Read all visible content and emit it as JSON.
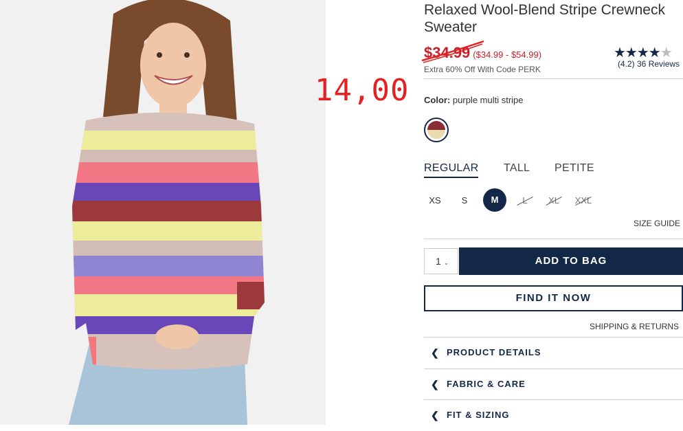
{
  "product": {
    "title": "Relaxed Wool-Blend Stripe Crewneck Sweater",
    "price_original": "$34.99",
    "price_range": "($34.99 - $54.99)",
    "promo": "Extra 60% Off With Code PERK",
    "rating_stars": "★★★★",
    "rating_empty_star": "★",
    "rating": 4.2,
    "reviews_text": "(4.2) 36 Reviews"
  },
  "annotation": {
    "handwritten_price": "14,00"
  },
  "color": {
    "label": "Color:",
    "value": "purple multi stripe"
  },
  "fit_tabs": [
    "REGULAR",
    "TALL",
    "PETITE"
  ],
  "sizes": [
    "XS",
    "S",
    "M",
    "L",
    "XL",
    "XXL"
  ],
  "size_guide": "SIZE GUIDE",
  "qty": {
    "value": "1"
  },
  "buttons": {
    "add_to_bag": "ADD TO BAG",
    "find_it_now": "FIND IT NOW"
  },
  "shipping_link": "SHIPPING & RETURNS",
  "accordions": [
    "PRODUCT DETAILS",
    "FABRIC & CARE",
    "FIT & SIZING"
  ],
  "colors": {
    "navy": "#132846",
    "sale_red": "#c9202b",
    "annotation_red": "#e52020"
  }
}
